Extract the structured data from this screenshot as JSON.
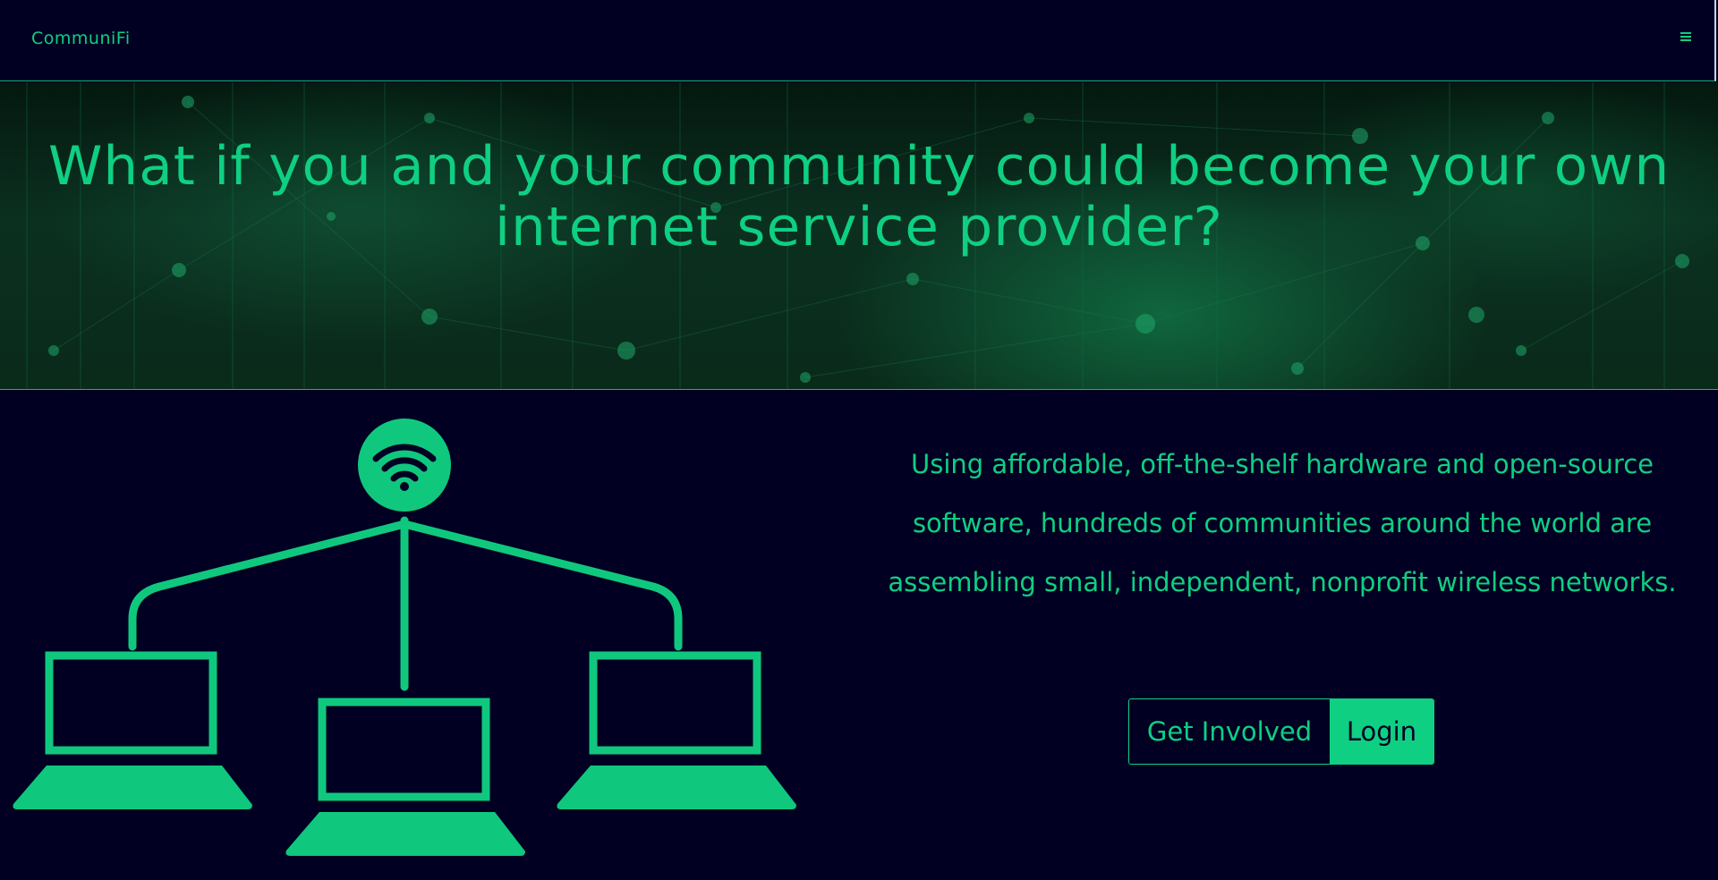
{
  "navbar": {
    "brand": "CommuniFi",
    "menu_icon": "hamburger-menu-icon"
  },
  "hero": {
    "title": "What if you and your community could become your own internet service provider?"
  },
  "illustration": {
    "icons": [
      "wifi-icon",
      "laptop-icon",
      "laptop-icon",
      "laptop-icon"
    ]
  },
  "main": {
    "description": "Using affordable, off-the-shelf hardware and open-source software, hundreds of communities around the world are assembling small, independent, nonprofit wireless networks.",
    "get_involved_label": "Get Involved",
    "login_label": "Login"
  },
  "colors": {
    "background": "#020022",
    "accent": "#0fcf82"
  }
}
